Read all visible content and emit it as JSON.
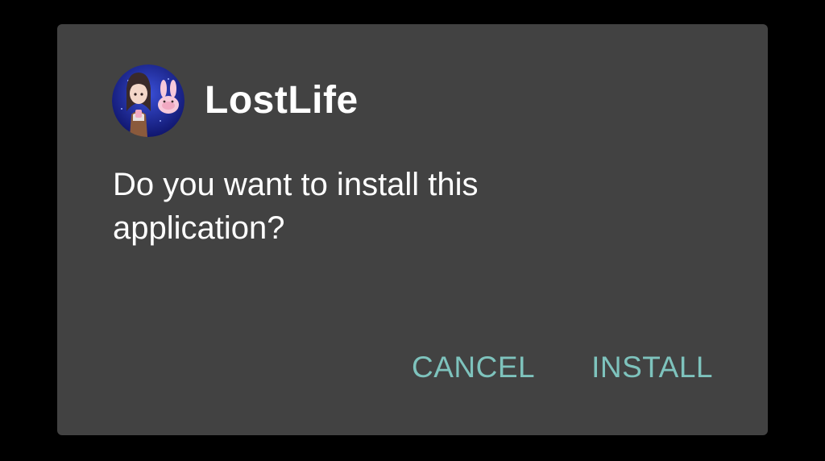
{
  "dialog": {
    "app_icon": "lostlife-app-icon",
    "app_name": "LostLife",
    "message": "Do you want to install this application?",
    "buttons": {
      "cancel": "CANCEL",
      "install": "INSTALL"
    }
  },
  "colors": {
    "backdrop": "#000000",
    "dialog_background": "#424242",
    "text": "#ffffff",
    "accent": "#7ec3bd"
  }
}
